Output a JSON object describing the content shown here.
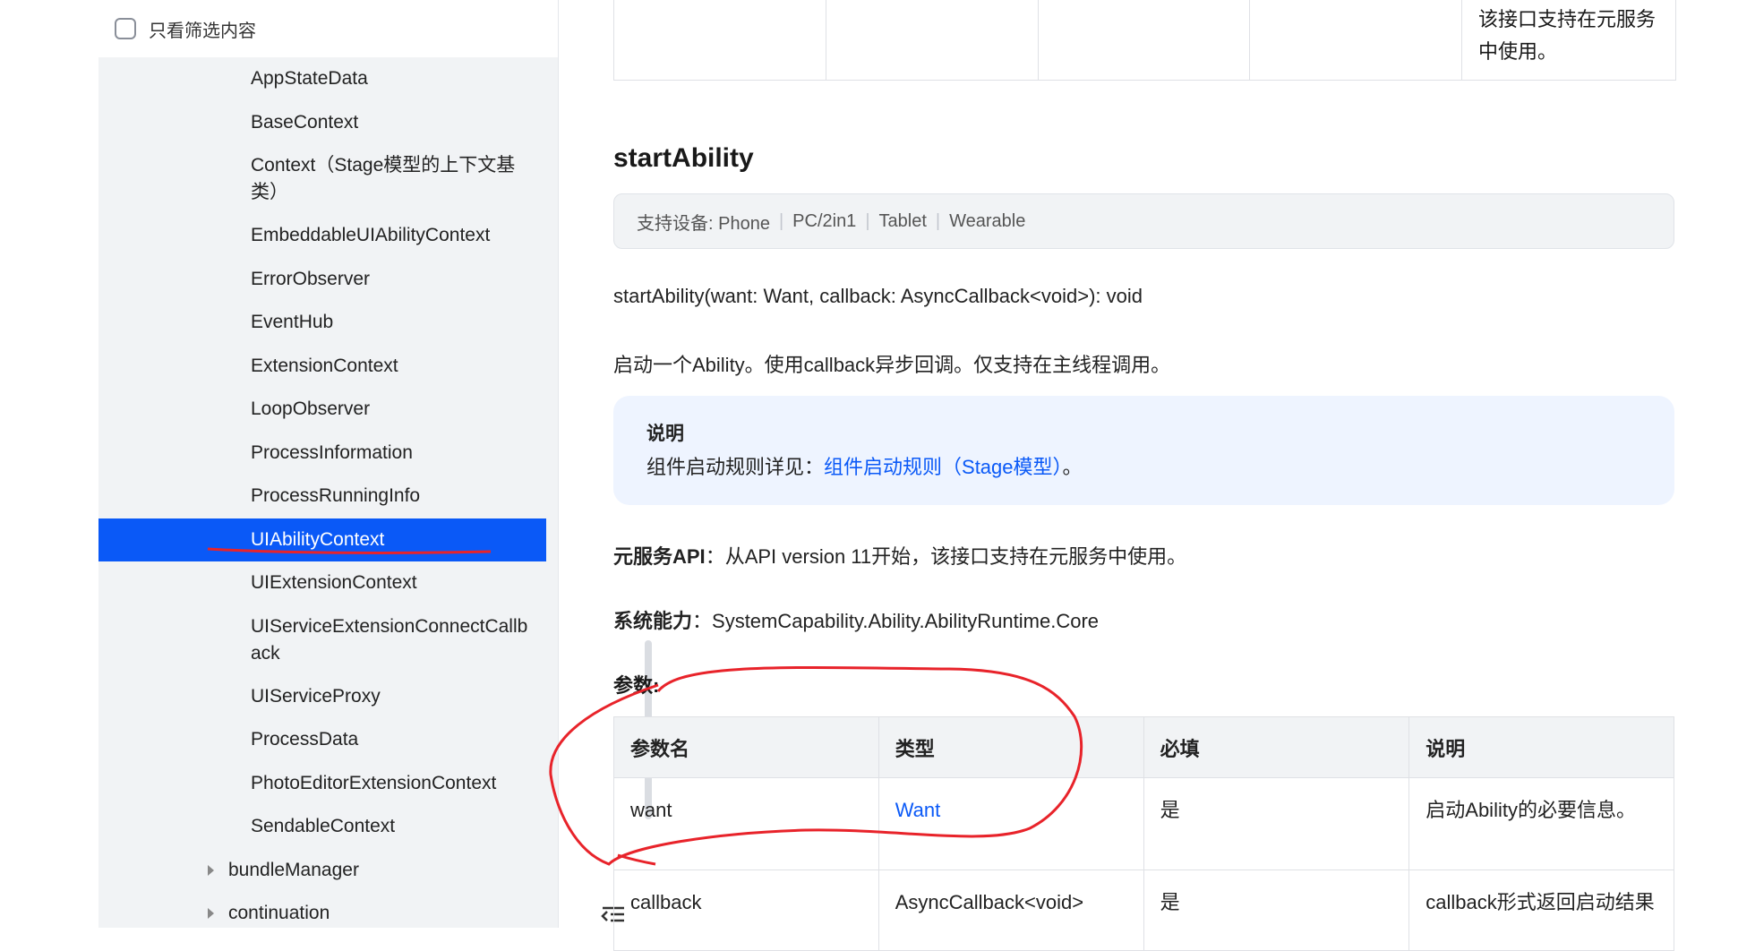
{
  "sidebar": {
    "filter_label": "只看筛选内容",
    "items": [
      {
        "label": "AppStateData",
        "lines": 1
      },
      {
        "label": "BaseContext",
        "lines": 1
      },
      {
        "label": "Context（Stage模型的上下文基类）",
        "lines": 2
      },
      {
        "label": "EmbeddableUIAbilityContext",
        "lines": 1
      },
      {
        "label": "ErrorObserver",
        "lines": 1
      },
      {
        "label": "EventHub",
        "lines": 1
      },
      {
        "label": "ExtensionContext",
        "lines": 1
      },
      {
        "label": "LoopObserver",
        "lines": 1
      },
      {
        "label": "ProcessInformation",
        "lines": 1
      },
      {
        "label": "ProcessRunningInfo",
        "lines": 1
      },
      {
        "label": "UIAbilityContext",
        "lines": 1,
        "selected": true
      },
      {
        "label": "UIExtensionContext",
        "lines": 1
      },
      {
        "label": "UIServiceExtensionConnectCallback",
        "lines": 2
      },
      {
        "label": "UIServiceProxy",
        "lines": 1
      },
      {
        "label": "ProcessData",
        "lines": 1
      },
      {
        "label": "PhotoEditorExtensionContext",
        "lines": 1
      },
      {
        "label": "SendableContext",
        "lines": 1
      }
    ],
    "parents": [
      {
        "label": "bundleManager"
      },
      {
        "label": "continuation"
      }
    ]
  },
  "top_table": {
    "last_cell": "该接口支持在元服务中使用。"
  },
  "api": {
    "title": "startAbility",
    "devices_label": "支持设备: Phone",
    "devices": [
      "PC/2in1",
      "Tablet",
      "Wearable"
    ],
    "signature": "startAbility(want: Want, callback: AsyncCallback<void>): void",
    "description": "启动一个Ability。使用callback异步回调。仅支持在主线程调用。",
    "note_title": "说明",
    "note_prefix": "组件启动规则详见：",
    "note_link": "组件启动规则（Stage模型）",
    "note_suffix": "。",
    "atomic_label": "元服务API",
    "atomic_text": "：从API version 11开始，该接口支持在元服务中使用。",
    "syscap_label": "系统能力",
    "syscap_text": "：SystemCapability.Ability.AbilityRuntime.Core",
    "params_label": "参数:"
  },
  "params_table": {
    "headers": [
      "参数名",
      "类型",
      "必填",
      "说明"
    ],
    "rows": [
      {
        "name": "want",
        "type": "Want",
        "required": "是",
        "desc": "启动Ability的必要信息。"
      },
      {
        "name": "callback",
        "type": "AsyncCallback<void>",
        "required": "是",
        "desc": "callback形式返回启动结果"
      }
    ]
  },
  "colors": {
    "accent": "#0a59f7",
    "annotation": "#e8232a"
  }
}
